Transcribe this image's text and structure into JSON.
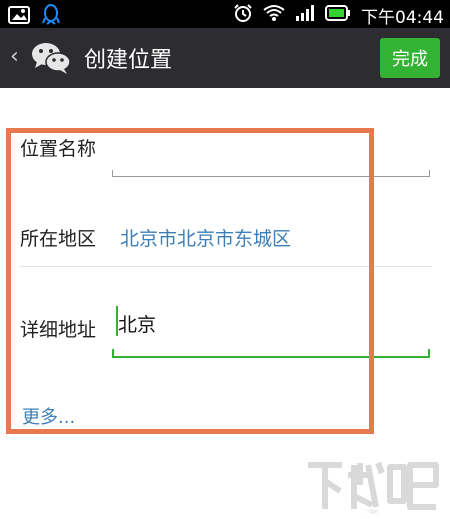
{
  "status_bar": {
    "time": "下午04:44",
    "icons": [
      "image-icon",
      "qq-icon",
      "alarm-icon",
      "wifi-icon",
      "signal-icon",
      "battery-icon"
    ]
  },
  "action_bar": {
    "title": "创建位置",
    "done_label": "完成",
    "back_icon": "chevron-left-icon",
    "logo_icon": "wechat-icon"
  },
  "form": {
    "name_label": "位置名称",
    "name_value": "",
    "region_label": "所在地区",
    "region_value": "北京市北京市东城区",
    "address_label": "详细地址",
    "address_value": "北京",
    "more_label": "更多..."
  },
  "colors": {
    "action_bar_bg": "#2d2d31",
    "done_button_bg": "#34b234",
    "link_blue": "#3d7fb8",
    "highlight_orange": "#e8784d",
    "active_underline": "#34b234"
  },
  "watermark": {
    "text": "下载吧"
  }
}
